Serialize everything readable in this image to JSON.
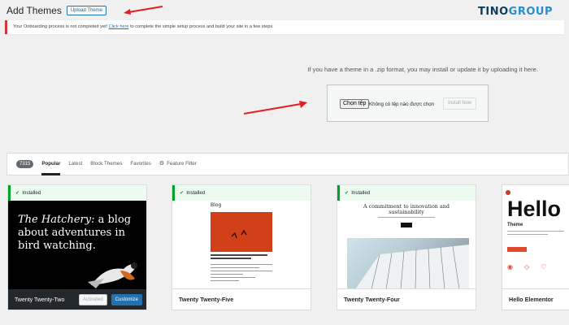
{
  "header": {
    "title": "Add Themes",
    "upload_button": "Upload Theme",
    "logo_part1": "TINO",
    "logo_part2": "GROUP"
  },
  "notice": {
    "prefix": "Your Onboarding process is not completed yet! ",
    "link": "Click here",
    "suffix": " to complete the simple setup process and build your site in a few steps."
  },
  "upload": {
    "description": "If you have a theme in a .zip format, you may install or update it by uploading it here.",
    "choose_file": "Chọn tệp",
    "no_file": "Không có tệp nào được chọn",
    "install_button": "Install Now"
  },
  "filter": {
    "count": "7315",
    "tabs": [
      "Popular",
      "Latest",
      "Block Themes",
      "Favorites"
    ],
    "feature_filter": "Feature Filter"
  },
  "themes": [
    {
      "status": "Installed",
      "name": "Twenty Twenty-Two",
      "activated_label": "Activated",
      "customize_label": "Customize",
      "preview_title_italic": "The Hatchery:",
      "preview_title_rest": " a blog about adventures in bird watching."
    },
    {
      "status": "Installed",
      "name": "Twenty Twenty-Five",
      "preview_heading": "Blog"
    },
    {
      "status": "Installed",
      "name": "Twenty Twenty-Four",
      "preview_heading": "A commitment to innovation and sustainability"
    },
    {
      "name": "Hello Elementor",
      "preview_heading": "Hello",
      "preview_sub": "Theme"
    }
  ],
  "colors": {
    "accent": "#2271b1",
    "notice_error": "#d63638",
    "installed_green": "#00a32a",
    "arrow_red": "#e02020"
  }
}
